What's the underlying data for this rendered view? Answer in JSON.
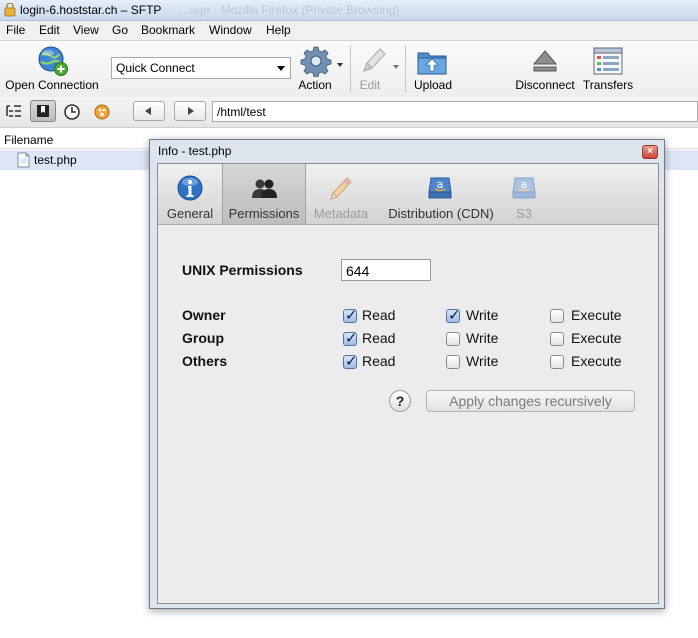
{
  "window": {
    "title": "login-6.hoststar.ch – SFTP",
    "ghost_title": "...age - Mozilla Firefox (Private Browsing)"
  },
  "menu": [
    "File",
    "Edit",
    "View",
    "Go",
    "Bookmark",
    "Window",
    "Help"
  ],
  "toolbar": {
    "open_connection": "Open Connection",
    "quick_connect": "Quick Connect",
    "action": "Action",
    "edit": "Edit",
    "upload": "Upload",
    "disconnect": "Disconnect",
    "transfers": "Transfers"
  },
  "navbar": {
    "path": "/html/test"
  },
  "browser": {
    "column_filename": "Filename",
    "files": [
      {
        "name": "test.php",
        "icon": "file-icon"
      }
    ]
  },
  "dialog": {
    "title": "Info - test.php",
    "tabs": [
      {
        "label": "General",
        "icon": "info-icon",
        "state": "normal"
      },
      {
        "label": "Permissions",
        "icon": "users-icon",
        "state": "active"
      },
      {
        "label": "Metadata",
        "icon": "pencil-icon",
        "state": "disabled"
      },
      {
        "label": "Distribution (CDN)",
        "icon": "amazon-icon",
        "state": "normal"
      },
      {
        "label": "S3",
        "icon": "amazon-icon",
        "state": "disabled"
      }
    ],
    "unix_permissions_label": "UNIX Permissions",
    "unix_permissions_value": "644",
    "columns": [
      "Read",
      "Write",
      "Execute"
    ],
    "rows": [
      {
        "label": "Owner",
        "read": true,
        "write": true,
        "execute": false
      },
      {
        "label": "Group",
        "read": true,
        "write": false,
        "execute": false
      },
      {
        "label": "Others",
        "read": true,
        "write": false,
        "execute": false
      }
    ],
    "help_label": "?",
    "apply_button": "Apply changes recursively"
  },
  "colors": {
    "accent_blue": "#2f73c9",
    "selection": "#dce6f4",
    "dialog_frame": "#dde4ee"
  }
}
